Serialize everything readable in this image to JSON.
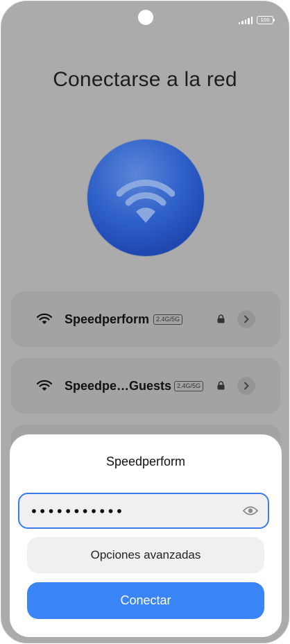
{
  "status_bar": {
    "battery_level": "100",
    "signal_icon": "cellular-signal-icon"
  },
  "screen": {
    "title": "Conectarse a la red"
  },
  "networks": [
    {
      "name": "Speedperform",
      "band": "2.4G/5G"
    },
    {
      "name": "Speedpe…Guests",
      "band": "2.4G/5G"
    }
  ],
  "dialog": {
    "title": "Speedperform",
    "password_value": "•••••••••••",
    "advanced_label": "Opciones avanzadas",
    "connect_label": "Conectar"
  },
  "colors": {
    "accent": "#3a85f6",
    "field_border": "#3a7bf3",
    "scrim": "#ababab"
  }
}
